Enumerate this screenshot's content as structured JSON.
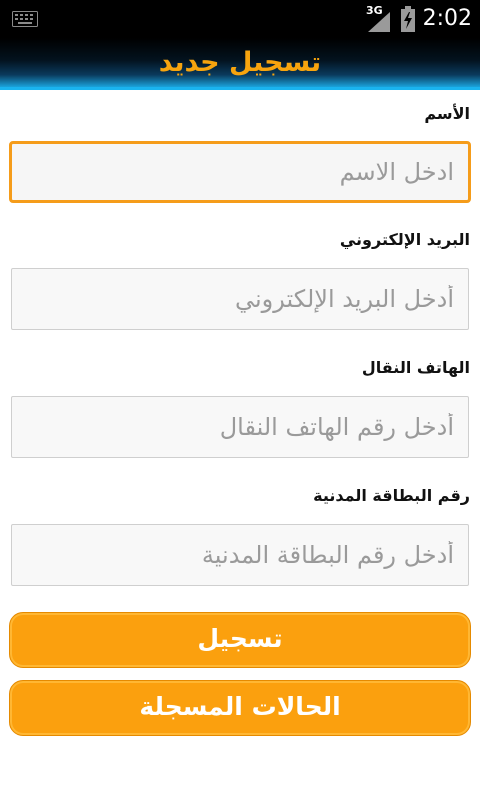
{
  "status_bar": {
    "network": "3G",
    "time": "2:02",
    "keyboard_icon": "keyboard-icon",
    "signal_icon": "signal-icon",
    "battery_icon": "battery-charging-icon"
  },
  "header": {
    "title": "تسجيل جديد"
  },
  "form": {
    "fields": [
      {
        "label": "الأسم",
        "placeholder": "ادخل الاسم",
        "value": ""
      },
      {
        "label": "البريد الإلكتروني",
        "placeholder": "أدخل البريد الإلكتروني",
        "value": ""
      },
      {
        "label": "الهاتف النقال",
        "placeholder": "أدخل رقم الهاتف النقال",
        "value": ""
      },
      {
        "label": "رقم البطاقة المدنية",
        "placeholder": "أدخل رقم البطاقة المدنية",
        "value": ""
      }
    ],
    "register_button": "تسجيل",
    "registered_cases_button": "الحالات المسجلة"
  },
  "colors": {
    "accent": "#fba00e",
    "title_text": "#f7a40e",
    "header_blue": "#1ab4f0",
    "focus_border": "#f59c1a"
  }
}
